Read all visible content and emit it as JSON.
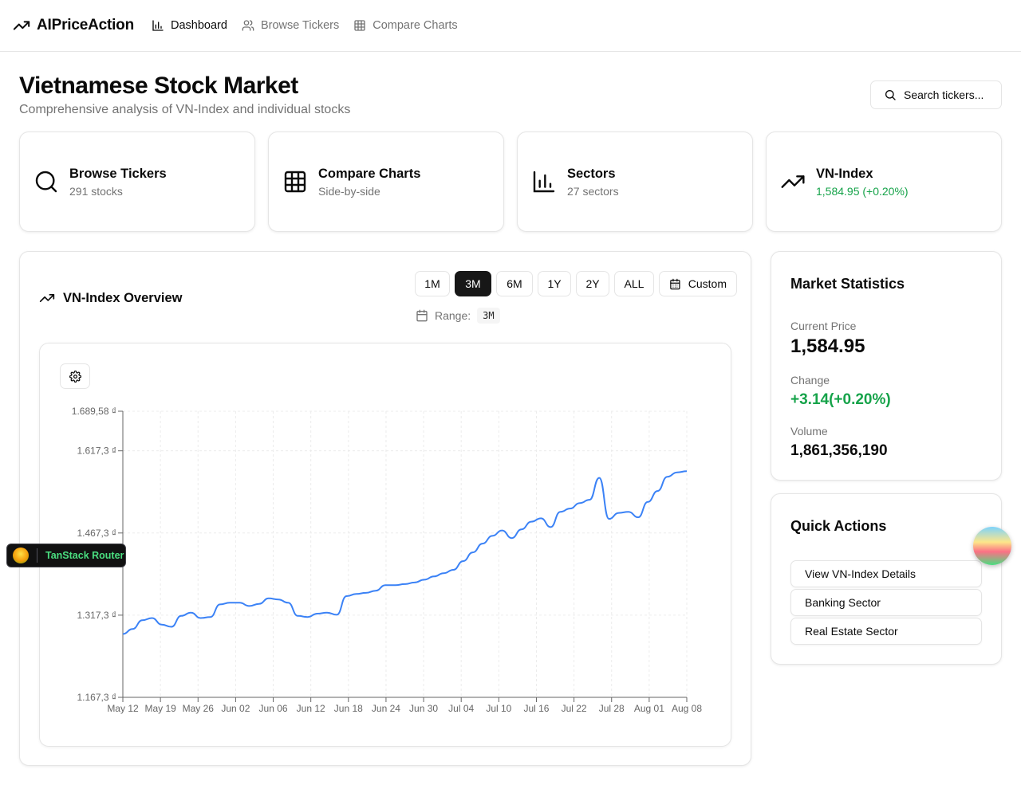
{
  "nav": {
    "brand": "AIPriceAction",
    "links": [
      "Dashboard",
      "Browse Tickers",
      "Compare Charts"
    ]
  },
  "header": {
    "title": "Vietnamese Stock Market",
    "subtitle": "Comprehensive analysis of VN-Index and individual stocks",
    "search_label": "Search tickers..."
  },
  "cards": [
    {
      "title": "Browse Tickers",
      "sub": "291 stocks",
      "icon": "search-icon"
    },
    {
      "title": "Compare Charts",
      "sub": "Side-by-side",
      "icon": "grid-icon"
    },
    {
      "title": "Sectors",
      "sub": "27 sectors",
      "icon": "bar-chart-icon"
    },
    {
      "title": "VN-Index",
      "sub": "1,584.95 (+0.20%)",
      "icon": "trending-up-icon"
    }
  ],
  "overview": {
    "title": "VN-Index Overview",
    "ranges": [
      "1M",
      "3M",
      "6M",
      "1Y",
      "2Y",
      "ALL"
    ],
    "custom_label": "Custom",
    "range_label": "Range:",
    "range_value": "3M",
    "active_range": "3M"
  },
  "chart_data": {
    "type": "line",
    "title": "",
    "xlabel": "",
    "ylabel": "",
    "ylim": [
      1167.3,
      1689.58
    ],
    "y_ticks": [
      "1.689,58 ₫",
      "1.617,3 ₫",
      "1.467,3 ₫",
      "1.317,3 ₫",
      "1.167,3 ₫"
    ],
    "y_tick_values": [
      1689.58,
      1617.3,
      1467.3,
      1317.3,
      1167.3
    ],
    "x_ticks": [
      "May 12",
      "May 19",
      "May 26",
      "Jun 02",
      "Jun 06",
      "Jun 12",
      "Jun 18",
      "Jun 24",
      "Jun 30",
      "Jul 04",
      "Jul 10",
      "Jul 16",
      "Jul 22",
      "Jul 28",
      "Aug 01",
      "Aug 08"
    ],
    "grid": true,
    "line_color": "#3b82f6",
    "series": [
      {
        "values": [
          1283,
          1292,
          1308,
          1312,
          1300,
          1296,
          1316,
          1322,
          1312,
          1314,
          1337,
          1340,
          1340,
          1334,
          1338,
          1348,
          1346,
          1340,
          1316,
          1314,
          1320,
          1322,
          1318,
          1352,
          1356,
          1358,
          1362,
          1372,
          1372,
          1374,
          1377,
          1382,
          1388,
          1394,
          1400,
          1416,
          1432,
          1448,
          1462,
          1472,
          1458,
          1474,
          1488,
          1494,
          1478,
          1506,
          1512,
          1522,
          1528,
          1568,
          1493,
          1504,
          1506,
          1496,
          1524,
          1544,
          1570,
          1578,
          1580
        ]
      }
    ]
  },
  "stats": {
    "title": "Market Statistics",
    "current_price_label": "Current Price",
    "current_price": "1,584.95",
    "change_label": "Change",
    "change": "+3.14(+0.20%)",
    "volume_label": "Volume",
    "volume": "1,861,356,190",
    "positive_color": "#16a34a"
  },
  "quick_actions": {
    "title": "Quick Actions",
    "items": [
      "View VN-Index Details",
      "Banking Sector",
      "Real Estate Sector"
    ]
  },
  "devtools": {
    "label": "TanStack Router"
  }
}
